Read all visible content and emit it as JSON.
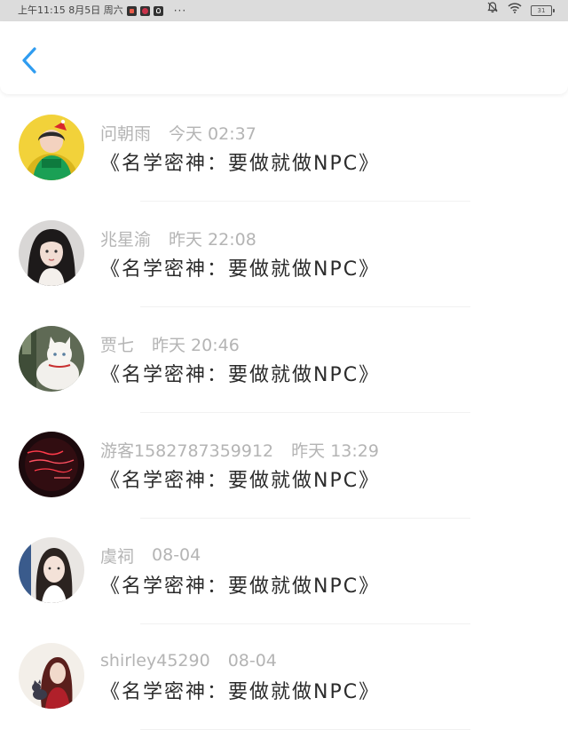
{
  "status_bar": {
    "left_text": "上午11:15 8月5日 周六",
    "more": "···",
    "battery": "31"
  },
  "header": {
    "back_icon": "chevron-left-icon",
    "accent_color": "#2f9cf0"
  },
  "comments": [
    {
      "user": "问朝雨",
      "time": "今天 02:37",
      "message": "《名学密神：要做就做NPC》"
    },
    {
      "user": "兆星渝",
      "time": "昨天 22:08",
      "message": "《名学密神：要做就做NPC》"
    },
    {
      "user": "贾七",
      "time": "昨天 20:46",
      "message": "《名学密神：要做就做NPC》"
    },
    {
      "user": "游客1582787359912",
      "time": "昨天 13:29",
      "message": "《名学密神：要做就做NPC》"
    },
    {
      "user": "虞祠",
      "time": "08-04",
      "message": "《名学密神：要做就做NPC》"
    },
    {
      "user": "shirley45290",
      "time": "08-04",
      "message": "《名学密神：要做就做NPC》"
    }
  ]
}
